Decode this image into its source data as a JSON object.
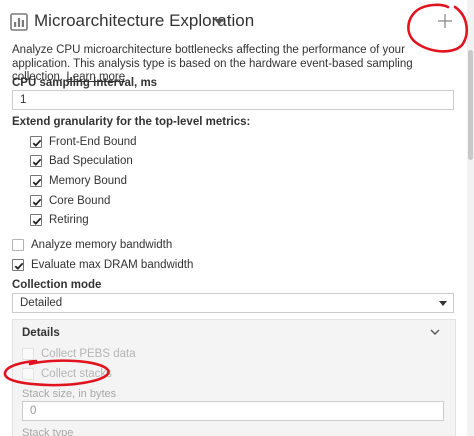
{
  "header": {
    "title": "Microarchitecture Exploration",
    "icon": "analysis-type-icon",
    "add_symbol": "+"
  },
  "description": {
    "text": "Analyze CPU microarchitecture bottlenecks affecting the performance of your application. This analysis type is based on the hardware event-based sampling collection.",
    "link": "Learn more"
  },
  "sampling": {
    "label": "CPU sampling interval, ms",
    "value": "1"
  },
  "granularity": {
    "label": "Extend granularity for the top-level metrics:",
    "items": [
      {
        "label": "Front-End Bound",
        "checked": true
      },
      {
        "label": "Bad Speculation",
        "checked": true
      },
      {
        "label": "Memory Bound",
        "checked": true
      },
      {
        "label": "Core Bound",
        "checked": true
      },
      {
        "label": "Retiring",
        "checked": true
      }
    ]
  },
  "options": {
    "memory_bandwidth": {
      "label": "Analyze memory bandwidth",
      "checked": false
    },
    "max_dram": {
      "label": "Evaluate max DRAM bandwidth",
      "checked": true
    }
  },
  "collection_mode": {
    "label": "Collection mode",
    "value": "Detailed"
  },
  "details": {
    "title": "Details",
    "pebs": {
      "label": "Collect PEBS data",
      "checked": false,
      "disabled": true
    },
    "stacks": {
      "label": "Collect stacks",
      "checked": false,
      "disabled": true
    },
    "stack_size": {
      "label": "Stack size, in bytes",
      "value": "0"
    },
    "stack_type": {
      "label": "Stack type"
    }
  },
  "colors": {
    "annotation_red": "#e0141e",
    "icon_gray": "#7a7a7a",
    "text": "#333333",
    "disabled_text": "#b5b5b5"
  }
}
